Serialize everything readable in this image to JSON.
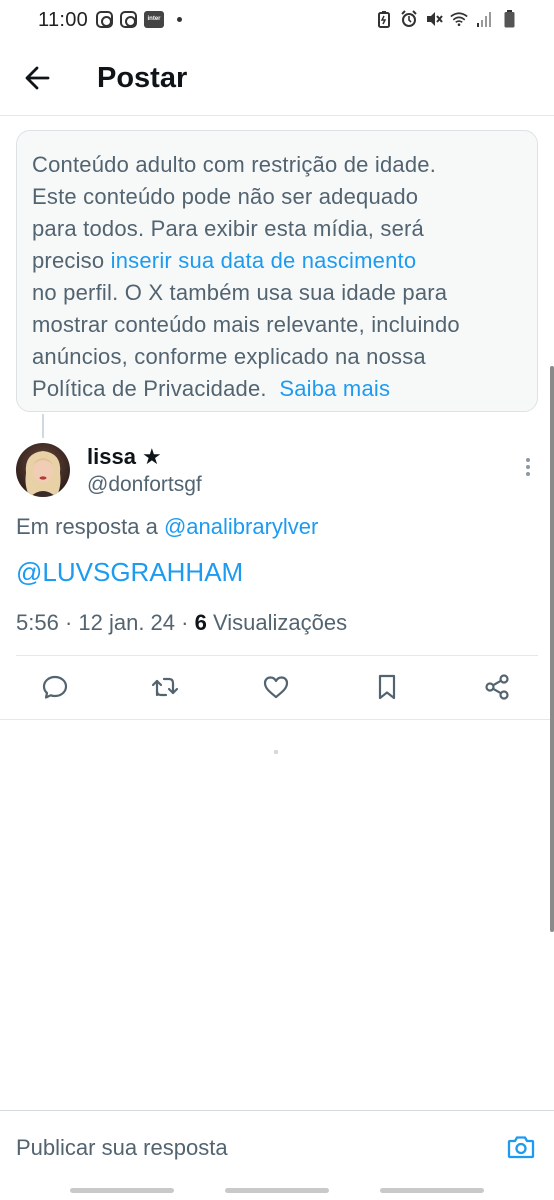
{
  "status_bar": {
    "time": "11:00",
    "inter_label": "inter"
  },
  "header": {
    "title": "Postar"
  },
  "notice": {
    "line1": "Conteúdo adulto com restrição de idade.",
    "line2": "Este conteúdo pode não ser adequado",
    "line3": "para todos. Para exibir esta mídia, será",
    "line4_prefix": "preciso ",
    "birthdate_link": "inserir sua data de nascimento",
    "line5": "no perfil. O X também usa sua idade para",
    "line6": "mostrar conteúdo mais relevante, incluindo",
    "line7": "anúncios, conforme explicado na nossa",
    "line8": "Política de Privacidade.",
    "learn_more": "Saiba mais"
  },
  "post": {
    "author_name": "lissa ★",
    "author_handle": "@donfortsgf",
    "reply_prefix": "Em resposta a ",
    "reply_to_handle": "@analibrarylver",
    "text": "@LUVSGRAHHAM",
    "time": "5:56",
    "date": "12 jan. 24",
    "views_count": "6",
    "views_label": "Visualizações"
  },
  "reply": {
    "placeholder": "Publicar sua resposta"
  },
  "colors": {
    "link": "#1d9bf0",
    "secondary_text": "#536471",
    "primary_text": "#0f1419",
    "notice_bg": "#f7f9f9"
  },
  "icons": {
    "back": "arrow-left-icon",
    "more": "more-vertical-icon",
    "reply": "comment-icon",
    "repost": "repost-icon",
    "like": "heart-icon",
    "bookmark": "bookmark-icon",
    "share": "share-icon",
    "camera": "camera-icon"
  }
}
